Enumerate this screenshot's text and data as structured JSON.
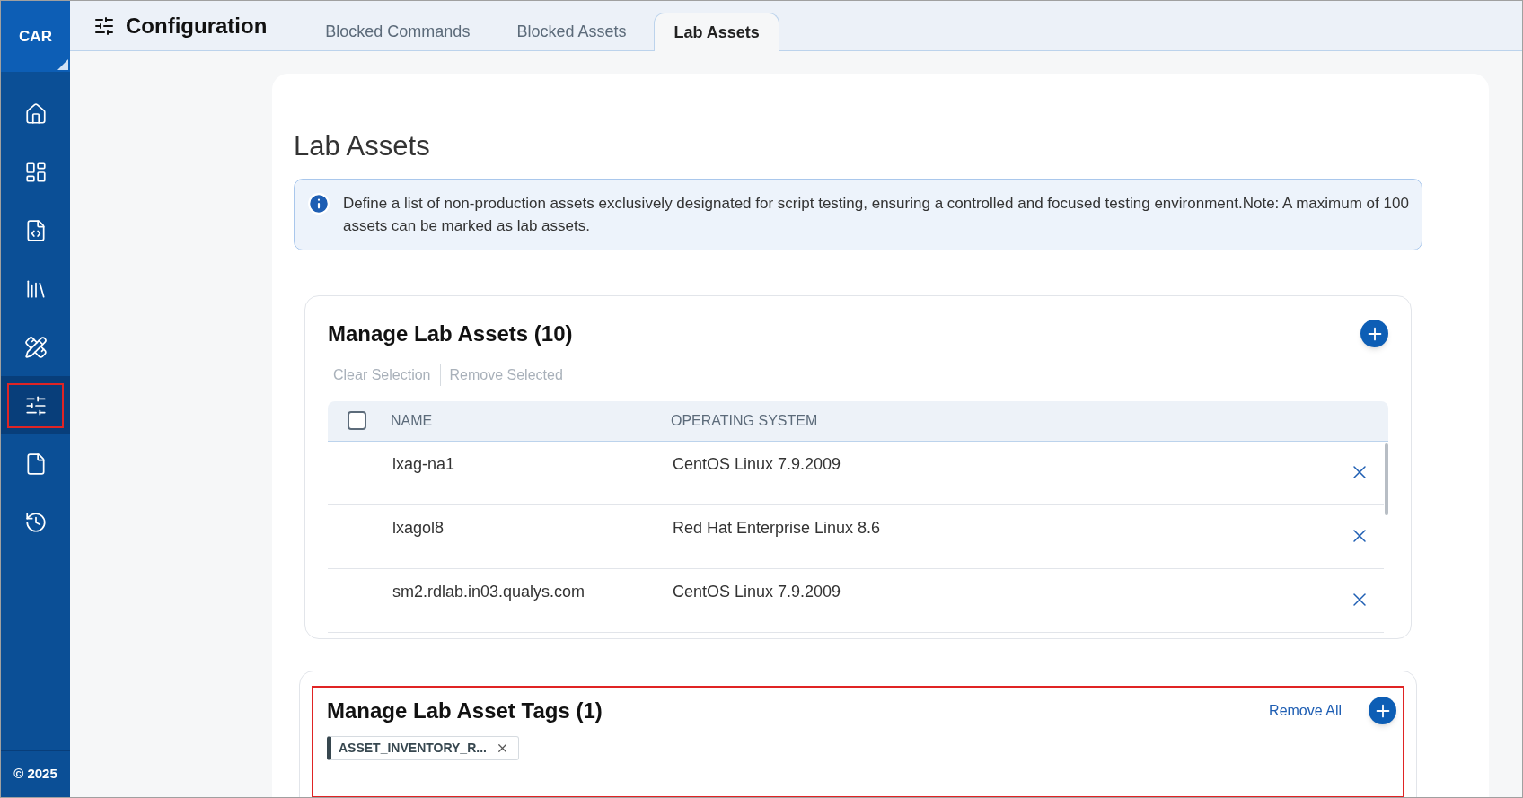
{
  "sidebar": {
    "logo": "CAR",
    "items": [
      {
        "kind": "home",
        "selected": false
      },
      {
        "kind": "dashboard",
        "selected": false
      },
      {
        "kind": "code",
        "selected": false
      },
      {
        "kind": "library",
        "selected": false
      },
      {
        "kind": "tools",
        "selected": false
      },
      {
        "kind": "sliders",
        "selected": true
      },
      {
        "kind": "file",
        "selected": false
      },
      {
        "kind": "history",
        "selected": false
      }
    ],
    "footer": "© 2025"
  },
  "header": {
    "title": "Configuration",
    "tabs": [
      {
        "label": "Blocked Commands",
        "selected": false
      },
      {
        "label": "Blocked Assets",
        "selected": false
      },
      {
        "label": "Lab Assets",
        "selected": true
      }
    ]
  },
  "page": {
    "title": "Lab Assets",
    "info": "Define a list of non-production assets exclusively designated for script testing, ensuring a controlled and focused testing environment.Note: A maximum of 100 assets can be marked as lab assets."
  },
  "assets": {
    "title": "Manage Lab Assets (10)",
    "actions": [
      "Clear Selection",
      "Remove Selected"
    ],
    "columns": [
      "NAME",
      "OPERATING SYSTEM"
    ],
    "select_all_checked": false,
    "rows": [
      {
        "name": "lxag-na1",
        "os": "CentOS Linux 7.9.2009"
      },
      {
        "name": "lxagol8",
        "os": "Red Hat Enterprise Linux 8.6"
      },
      {
        "name": "sm2.rdlab.in03.qualys.com",
        "os": "CentOS Linux 7.9.2009"
      }
    ]
  },
  "tags": {
    "title": "Manage Lab Asset Tags (1)",
    "remove_all": "Remove All",
    "items": [
      "ASSET_INVENTORY_R..."
    ]
  }
}
